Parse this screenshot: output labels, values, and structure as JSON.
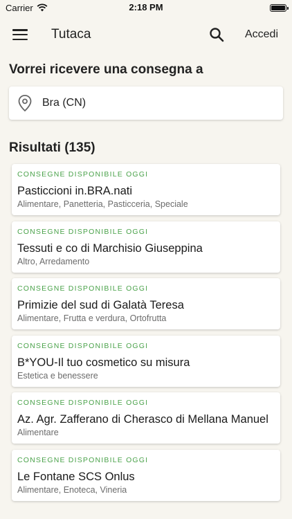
{
  "status_bar": {
    "carrier": "Carrier",
    "time": "2:18 PM"
  },
  "app_bar": {
    "title": "Tutaca",
    "login_label": "Accedi"
  },
  "delivery": {
    "heading": "Vorrei ricevere una consegna a",
    "location": "Bra (CN)"
  },
  "results": {
    "heading": "Risultati (135)",
    "items": [
      {
        "badge": "CONSEGNE DISPONIBILE OGGI",
        "name": "Pasticcioni in.BRA.nati",
        "categories": "Alimentare, Panetteria, Pasticceria, Speciale"
      },
      {
        "badge": "CONSEGNE DISPONIBILE OGGI",
        "name": "Tessuti e co di Marchisio Giuseppina",
        "categories": "Altro, Arredamento"
      },
      {
        "badge": "CONSEGNE DISPONIBILE OGGI",
        "name": "Primizie del sud di Galatà Teresa",
        "categories": "Alimentare, Frutta e verdura, Ortofrutta"
      },
      {
        "badge": "CONSEGNE DISPONIBILE OGGI",
        "name": "B*YOU-Il tuo cosmetico su misura",
        "categories": "Estetica e benessere"
      },
      {
        "badge": "CONSEGNE DISPONIBILE OGGI",
        "name": "Az. Agr. Zafferano di Cherasco di Mellana Manuel",
        "categories": "Alimentare"
      },
      {
        "badge": "CONSEGNE DISPONIBILE OGGI",
        "name": "Le Fontane SCS Onlus",
        "categories": "Alimentare, Enoteca, Vineria"
      }
    ]
  },
  "colors": {
    "badge_green": "#4aa24a",
    "background": "#f7f5ef"
  }
}
